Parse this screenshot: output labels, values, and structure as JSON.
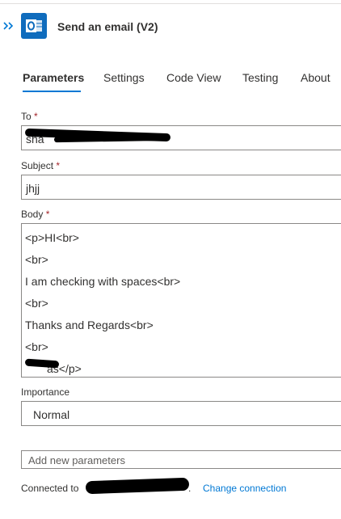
{
  "header": {
    "title": "Send an email (V2)",
    "expand_icon": "double-chevron-right-icon",
    "app_icon": "outlook-icon"
  },
  "tabs": [
    {
      "label": "Parameters",
      "active": true
    },
    {
      "label": "Settings",
      "active": false
    },
    {
      "label": "Code View",
      "active": false
    },
    {
      "label": "Testing",
      "active": false
    },
    {
      "label": "About",
      "active": false
    }
  ],
  "fields": {
    "to": {
      "label": "To",
      "required_mark": "*",
      "value": "sha"
    },
    "subject": {
      "label": "Subject",
      "required_mark": "*",
      "value": "jhjj"
    },
    "body": {
      "label": "Body",
      "required_mark": "*",
      "lines": [
        "<p>HI<br>",
        "<br>",
        "I am checking with spaces<br>",
        "<br>",
        "Thanks and Regards<br>",
        "<br>",
        "as</p>"
      ]
    },
    "importance": {
      "label": "Importance",
      "value": "Normal"
    },
    "add_params": {
      "placeholder": "Add new parameters"
    }
  },
  "footer": {
    "prefix": "Connected to",
    "suffix": ".",
    "link": "Change connection"
  },
  "colors": {
    "accent": "#0078d4",
    "required": "#a4262c",
    "app_icon_bg": "#0f6cbd"
  }
}
